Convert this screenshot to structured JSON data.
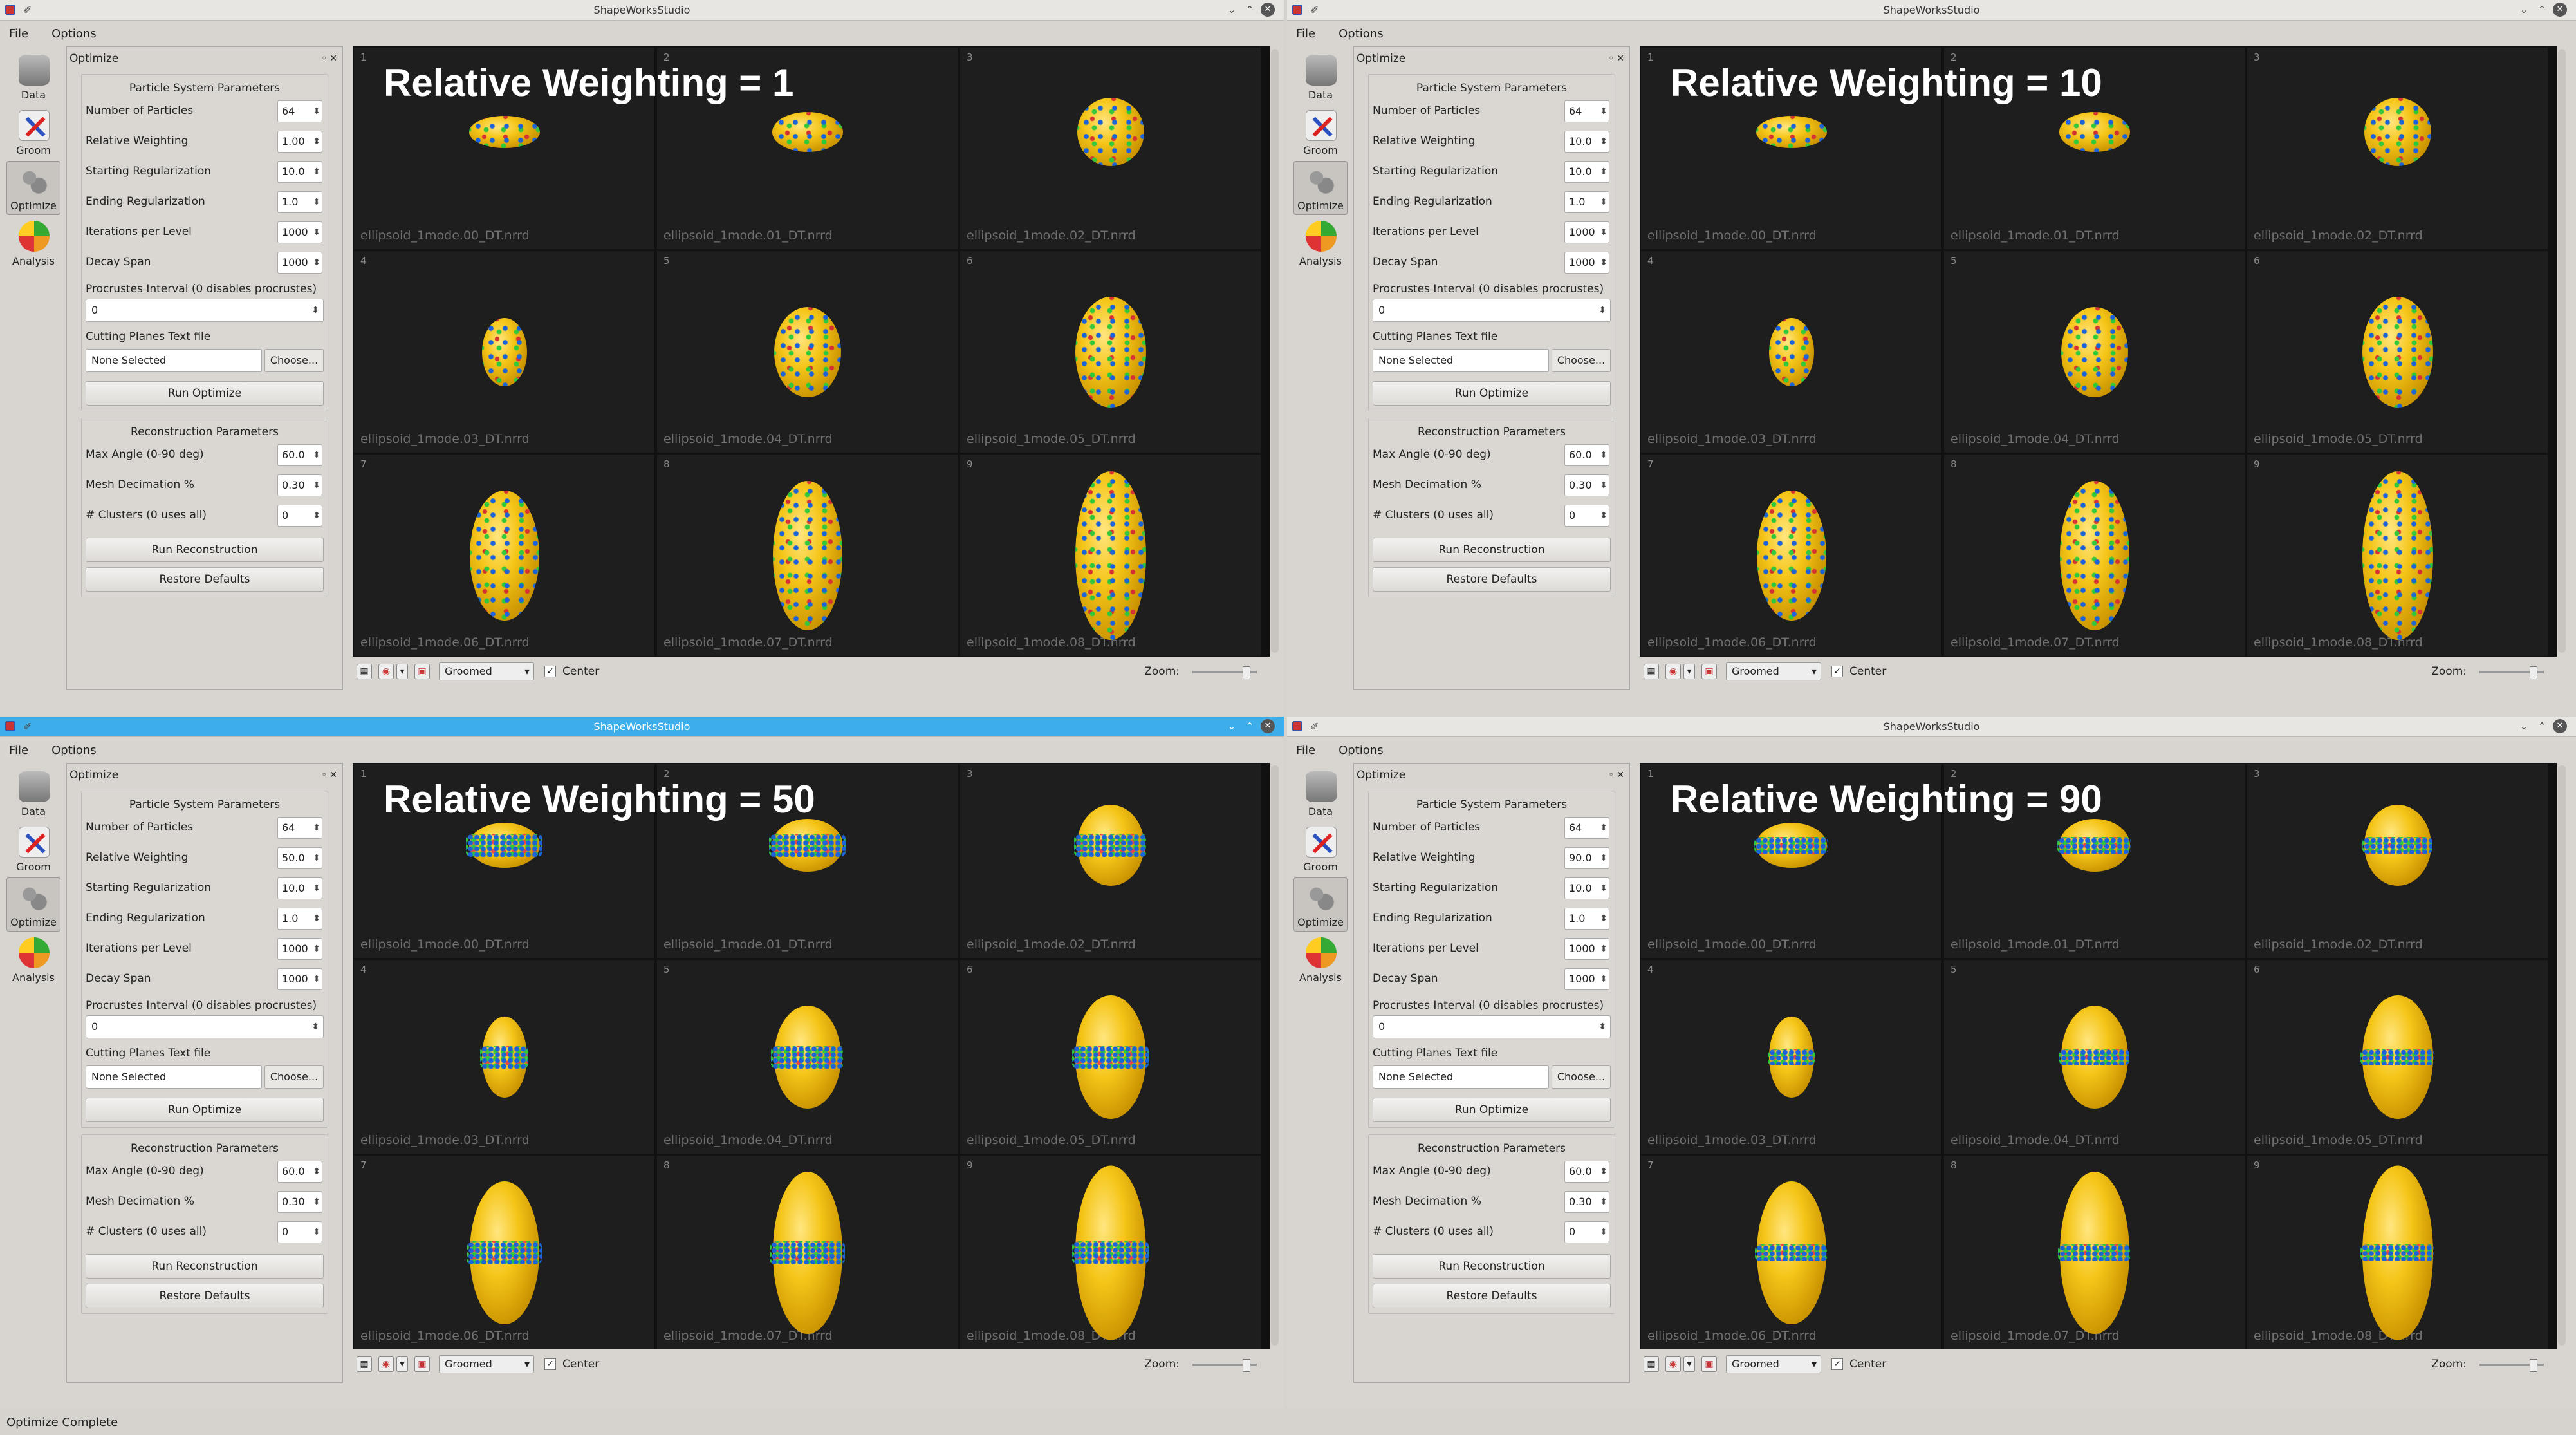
{
  "app_title": "ShapeWorksStudio",
  "menu": [
    "File",
    "Options"
  ],
  "tools": [
    "Data",
    "Groom",
    "Optimize",
    "Analysis"
  ],
  "panel": {
    "title": "Optimize",
    "particle_group_title": "Particle System Parameters",
    "labels": {
      "num_particles": "Number of Particles",
      "relative_weighting": "Relative Weighting",
      "starting_reg": "Starting Regularization",
      "ending_reg": "Ending Regularization",
      "iterations": "Iterations per Level",
      "decay_span": "Decay Span",
      "procrustes": "Procrustes Interval (0 disables procrustes)",
      "cutting_planes": "Cutting Planes Text file"
    },
    "values": {
      "num_particles": "64",
      "starting_reg": "10.0",
      "ending_reg": "1.0",
      "iterations": "1000",
      "decay_span": "1000",
      "procrustes": "0"
    },
    "cutting_file": "None Selected",
    "choose_button": "Choose...",
    "run_optimize": "Run Optimize",
    "recon_group_title": "Reconstruction Parameters",
    "recon_labels": {
      "max_angle": "Max Angle (0-90 deg)",
      "mesh_decimation": "Mesh Decimation %",
      "clusters": "# Clusters (0 uses all)"
    },
    "recon_values": {
      "max_angle": "60.0",
      "mesh_decimation": "0.30",
      "clusters": "0"
    },
    "run_reconstruction": "Run Reconstruction",
    "restore_defaults": "Restore Defaults"
  },
  "files": [
    "ellipsoid_1mode.00_DT.nrrd",
    "ellipsoid_1mode.01_DT.nrrd",
    "ellipsoid_1mode.02_DT.nrrd",
    "ellipsoid_1mode.03_DT.nrrd",
    "ellipsoid_1mode.04_DT.nrrd",
    "ellipsoid_1mode.05_DT.nrrd",
    "ellipsoid_1mode.06_DT.nrrd",
    "ellipsoid_1mode.07_DT.nrrd",
    "ellipsoid_1mode.08_DT.nrrd"
  ],
  "cell_numbers": [
    "1",
    "2",
    "3",
    "4",
    "5",
    "6",
    "7",
    "8",
    "9"
  ],
  "windows": [
    {
      "weighting_value": "1.00",
      "overlay_title": "Relative Weighting = 1"
    },
    {
      "weighting_value": "10.0",
      "overlay_title": "Relative Weighting = 10"
    },
    {
      "weighting_value": "50.0",
      "overlay_title": "Relative Weighting = 50"
    },
    {
      "weighting_value": "90.0",
      "overlay_title": "Relative Weighting = 90"
    }
  ],
  "bottom": {
    "mode": "Groomed",
    "center_label": "Center",
    "zoom_label": "Zoom:"
  },
  "status": "Optimize Complete",
  "colors": {
    "active_titlebar": "#3daee9",
    "shape": "#f5c518",
    "particle_blue": "#1b63d9",
    "particle_green": "#31c83b",
    "particle_red": "#d63232"
  }
}
